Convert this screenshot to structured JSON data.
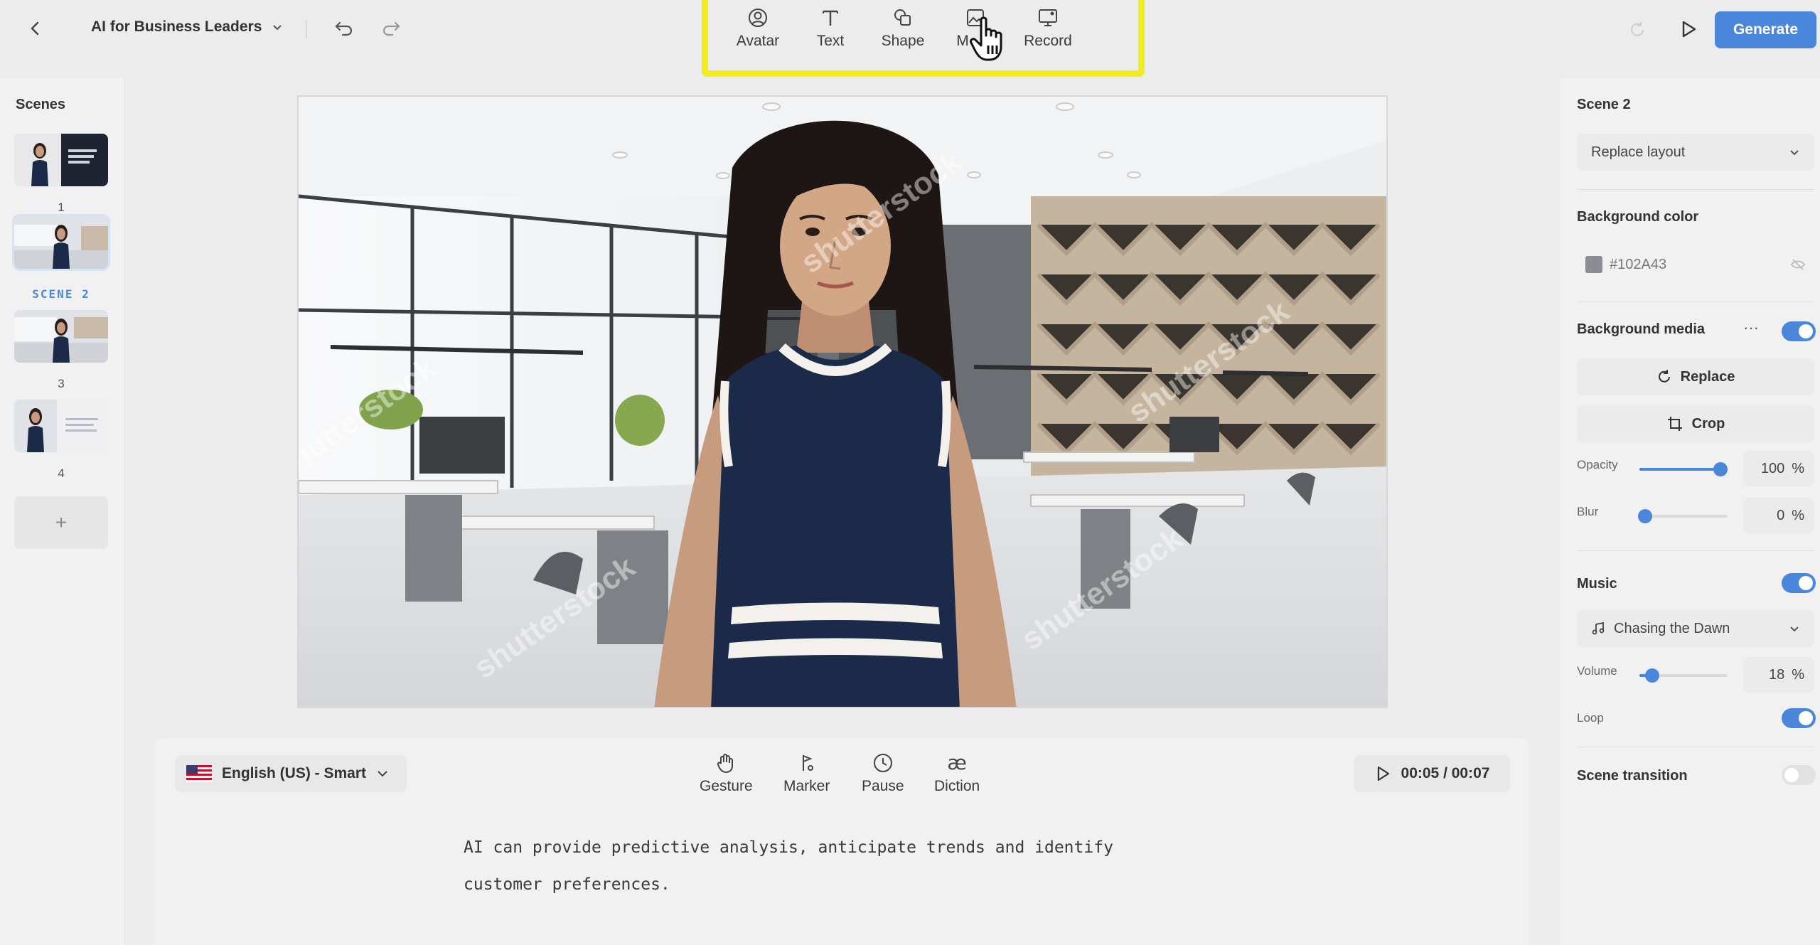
{
  "header": {
    "project_title": "AI for Business Leaders",
    "generate_label": "Generate"
  },
  "toolbar": {
    "items": [
      {
        "label": "Avatar",
        "icon": "avatar-icon"
      },
      {
        "label": "Text",
        "icon": "text-icon"
      },
      {
        "label": "Shape",
        "icon": "shape-icon"
      },
      {
        "label": "M",
        "icon": "media-icon"
      },
      {
        "label": "Record",
        "icon": "record-icon"
      }
    ]
  },
  "scenes": {
    "title": "Scenes",
    "items": [
      {
        "label": "1"
      },
      {
        "label": "SCENE 2"
      },
      {
        "label": "3"
      },
      {
        "label": "4"
      }
    ],
    "add_label": "+"
  },
  "script": {
    "language": "English (US) - Smart",
    "tools": [
      {
        "label": "Gesture",
        "icon": "gesture-icon"
      },
      {
        "label": "Marker",
        "icon": "marker-icon"
      },
      {
        "label": "Pause",
        "icon": "pause-clock-icon"
      },
      {
        "label": "Diction",
        "icon": "diction-icon"
      }
    ],
    "time": "00:05 / 00:07",
    "text_line1": "AI can provide predictive analysis, anticipate trends and identify",
    "text_line2": "customer preferences."
  },
  "properties": {
    "scene_title": "Scene 2",
    "layout_select": "Replace layout",
    "bg_color_label": "Background color",
    "bg_color_value": "#102A43",
    "bg_media_label": "Background media",
    "bg_media_more": "···",
    "replace_label": "Replace",
    "crop_label": "Crop",
    "opacity_label": "Opacity",
    "opacity_value": "100",
    "blur_label": "Blur",
    "blur_value": "0",
    "percent": "%",
    "music_label": "Music",
    "music_track": "Chasing the Dawn",
    "volume_label": "Volume",
    "volume_value": "18",
    "loop_label": "Loop",
    "transition_label": "Scene transition",
    "toggles": {
      "bg_media": true,
      "music": true,
      "loop": true,
      "scene_transition": false
    }
  },
  "colors": {
    "accent": "#4a86d9",
    "highlight": "#f2ec1e",
    "dress": "#1c2a4a"
  },
  "watermark": "shutterstock"
}
